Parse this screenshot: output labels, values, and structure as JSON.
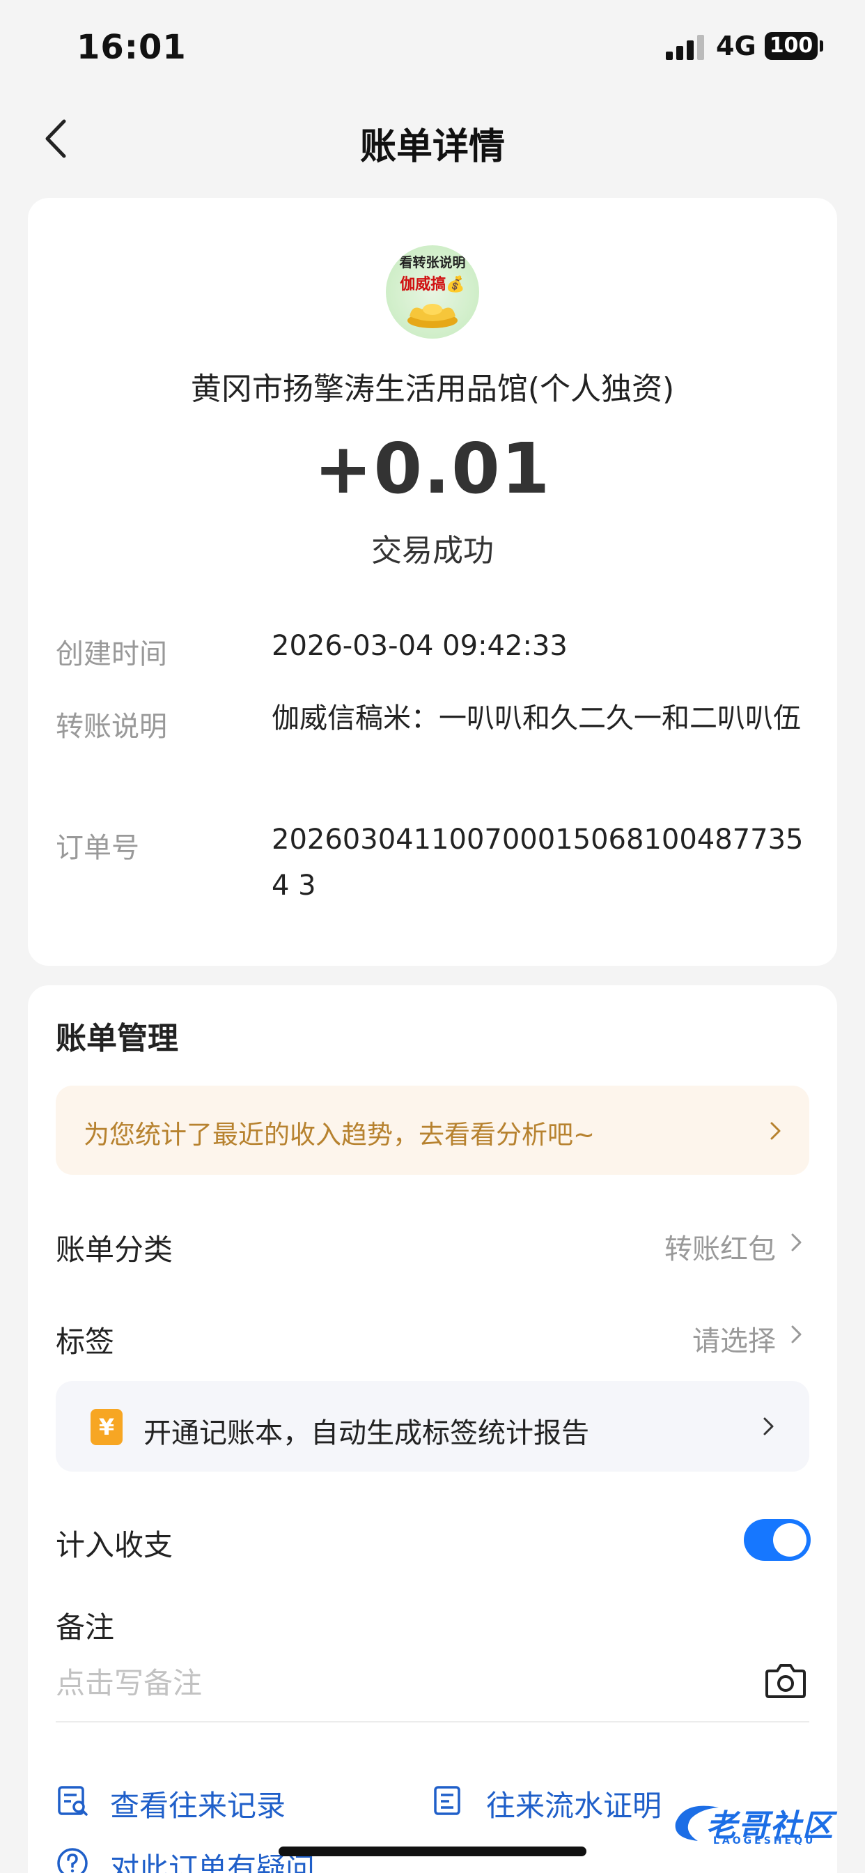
{
  "status_bar": {
    "time": "16:01",
    "network": "4G",
    "battery": "100"
  },
  "nav": {
    "title": "账单详情"
  },
  "bill": {
    "avatar": {
      "line1": "看转张说明",
      "line2": "伽威搞💰"
    },
    "merchant": "黄冈市扬擎涛生活用品馆(个人独资)",
    "amount": "+0.01",
    "status": "交易成功",
    "details": [
      {
        "label": "创建时间",
        "value": "2026-03-04 09:42:33"
      },
      {
        "label": "转账说明",
        "value": "伽威信稿米：一叭叭和久二久一和二叭叭伍"
      },
      {
        "label": "订单号",
        "value": "2026030411007000150681004877354 3"
      }
    ]
  },
  "management": {
    "title": "账单管理",
    "tip": "为您统计了最近的收入趋势，去看看分析吧~",
    "category_label": "账单分类",
    "category_value": "转账红包",
    "tag_label": "标签",
    "tag_value": "请选择",
    "notebook_icon": "¥",
    "notebook_text": "开通记账本，自动生成标签统计报告",
    "count_label": "计入收支",
    "count_enabled": true,
    "memo_label": "备注",
    "memo_placeholder": "点击写备注",
    "links": {
      "records": "查看往来记录",
      "proof": "往来流水证明",
      "question": "对此订单有疑问"
    }
  },
  "watermark": {
    "text": "老哥社区",
    "sub": "LAOGESHEQU"
  },
  "colors": {
    "accent": "#1677ff",
    "tip_text": "#b7822f",
    "link": "#1f5fc9"
  }
}
